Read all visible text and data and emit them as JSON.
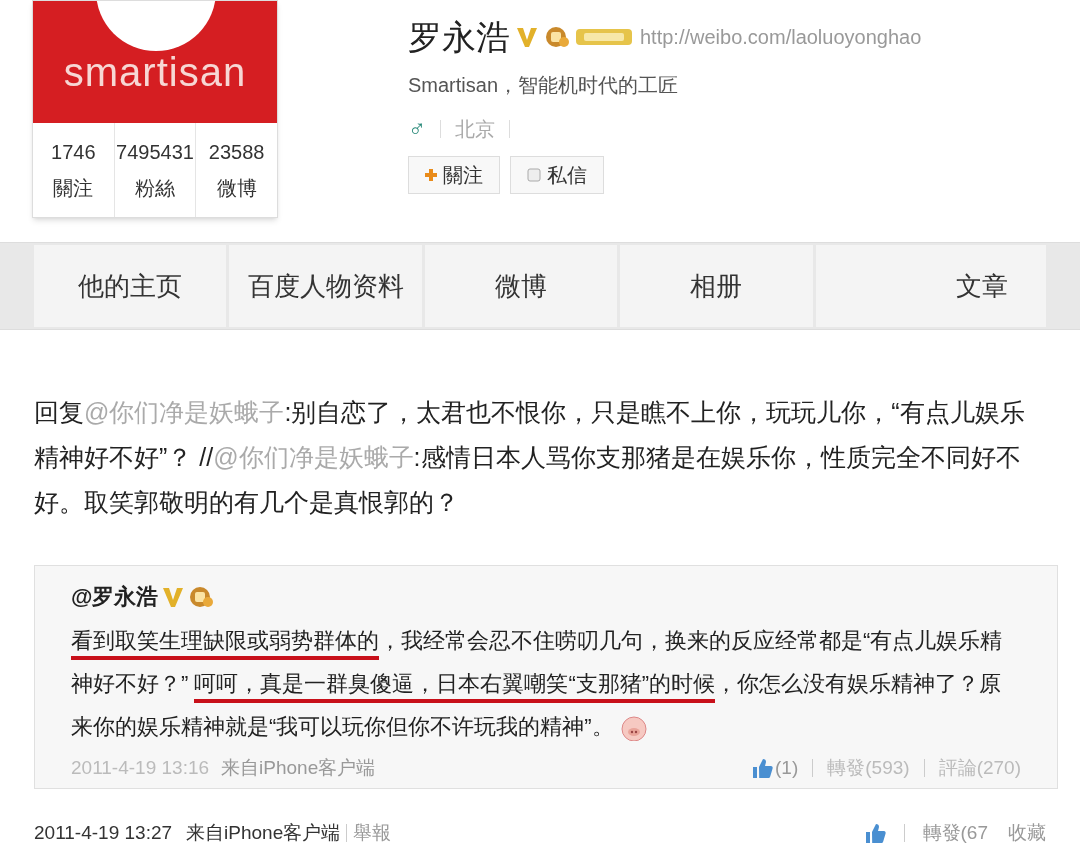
{
  "profile": {
    "logo": "smartisan",
    "stats": [
      {
        "value": "1746",
        "label": "關注"
      },
      {
        "value": "7495431",
        "label": "粉絲"
      },
      {
        "value": "23588",
        "label": "微博"
      }
    ],
    "name": "罗永浩",
    "url": "http://weibo.com/laoluoyonghao",
    "bio": "Smartisan，智能机时代的工匠",
    "gender": "♂",
    "location": "北京",
    "buttons": [
      {
        "kind": "follow",
        "label": "關注"
      },
      {
        "kind": "message",
        "label": "私信"
      }
    ]
  },
  "tabs": [
    {
      "label": "他的主页"
    },
    {
      "label": "百度人物资料"
    },
    {
      "label": "微博"
    },
    {
      "label": "相册"
    },
    {
      "label": "文章"
    }
  ],
  "post": {
    "segments": [
      {
        "kind": "text",
        "text": "回复"
      },
      {
        "kind": "mention",
        "text": "@你们净是妖蛾子"
      },
      {
        "kind": "text",
        "text": ":别自恋了，太君也不恨你，只是瞧不上你，玩玩儿你，“有点儿娱乐精神好不好”？ //"
      },
      {
        "kind": "mention",
        "text": "@你们净是妖蛾子"
      },
      {
        "kind": "text",
        "text": ":感情日本人骂你支那猪是在娱乐你，性质完全不同好不好。取笑郭敬明的有几个是真恨郭的？"
      }
    ],
    "quote": {
      "author": "@罗永浩",
      "segments": [
        {
          "text": "看到取笑生理缺限或弱势群体的",
          "underlined": true
        },
        {
          "text": "，我经常会忍不住唠叨几句，换来的反应经常都是“有点儿娱乐精神好不好？” ",
          "underlined": false
        },
        {
          "text": "呵呵，真是一群臭傻逼，日本右翼嘲笑“支那猪”的时候",
          "underlined": true
        },
        {
          "text": "，你怎么没有娱乐精神了？原来你的娱乐精神就是“我可以玩你但你不许玩我的精神”。",
          "underlined": false
        }
      ],
      "time": "2011-4-19 13:16",
      "source": "来自iPhone客户端",
      "likes": "(1)",
      "reposts": "轉發(593)",
      "comments": "評論(270)"
    },
    "time": "2011-4-19 13:27",
    "source": "来自iPhone客户端",
    "report": "舉報",
    "reposts": "轉發(67",
    "favorite": "收藏"
  }
}
